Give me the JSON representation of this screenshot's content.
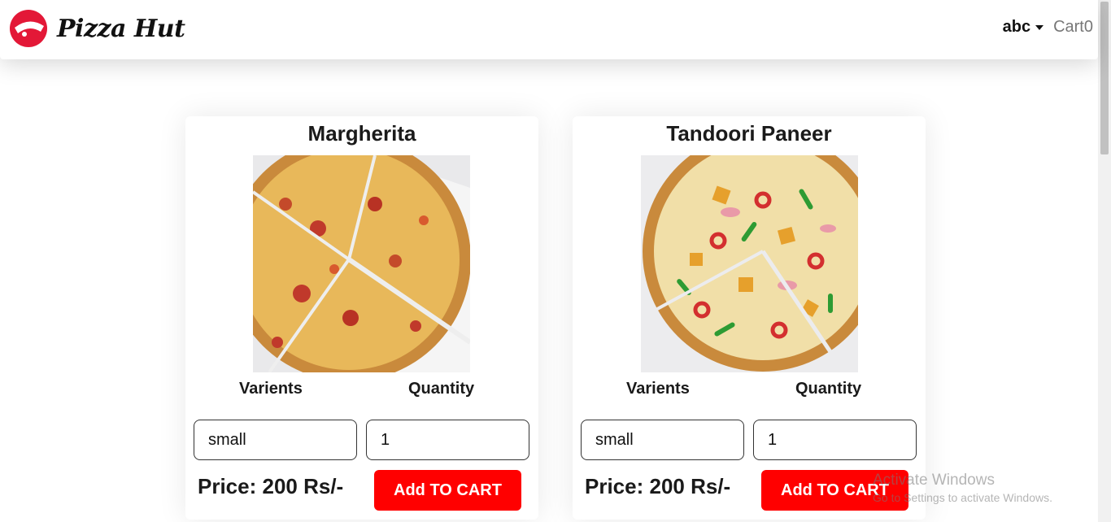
{
  "header": {
    "brand": "Pizza Hut",
    "user_name": "abc",
    "cart_label": "Cart",
    "cart_count": "0",
    "brand_color": "#e31837"
  },
  "products": [
    {
      "name": "Margherita",
      "image_icon": "margherita-pizza-photo",
      "variants_label": "Varients",
      "quantity_label": "Quantity",
      "variant": "small",
      "quantity": "1",
      "price_text": "Price: 200 Rs/-",
      "add_label": "Add TO CART"
    },
    {
      "name": "Tandoori Paneer",
      "image_icon": "tandoori-paneer-pizza-photo",
      "variants_label": "Varients",
      "quantity_label": "Quantity",
      "variant": "small",
      "quantity": "1",
      "price_text": "Price: 200 Rs/-",
      "add_label": "Add TO CART"
    }
  ],
  "colors": {
    "accent": "#ff0000"
  },
  "watermark": {
    "title": "Activate Windows",
    "subtitle": "Go to Settings to activate Windows."
  }
}
